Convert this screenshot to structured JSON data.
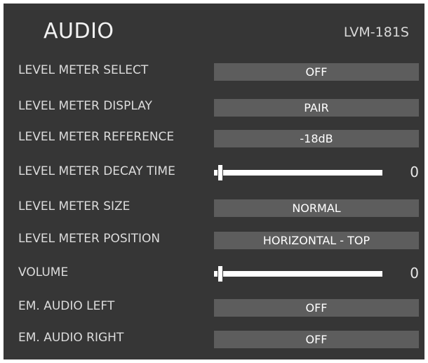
{
  "header": {
    "title": "AUDIO",
    "model": "LVM-181S"
  },
  "rows": [
    {
      "label": "LEVEL METER SELECT",
      "value": "OFF"
    },
    {
      "label": "LEVEL METER DISPLAY",
      "value": "PAIR"
    },
    {
      "label": "LEVEL METER REFERENCE",
      "value": "-18dB"
    },
    {
      "label": "LEVEL METER DECAY TIME",
      "value": "0",
      "slider_fraction": 0.0
    },
    {
      "label": "LEVEL METER SIZE",
      "value": "NORMAL"
    },
    {
      "label": "LEVEL METER POSITION",
      "value": "HORIZONTAL - TOP"
    },
    {
      "label": "VOLUME",
      "value": "0",
      "slider_fraction": 0.0
    },
    {
      "label": "EM. AUDIO LEFT",
      "value": "OFF"
    },
    {
      "label": "EM. AUDIO RIGHT",
      "value": "OFF"
    }
  ]
}
